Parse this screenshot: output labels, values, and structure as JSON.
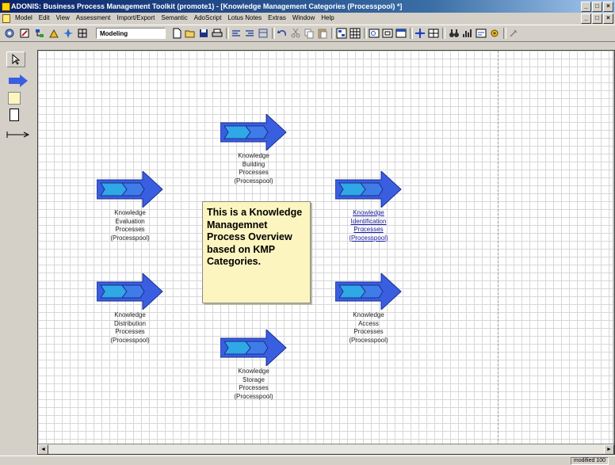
{
  "window": {
    "title": "ADONIS: Business Process Management Toolkit (promote1) - [Knowledge Management Categories (Processpool) *]",
    "min_glyph": "_",
    "max_glyph": "□",
    "close_glyph": "×"
  },
  "menubar": {
    "items": [
      "Model",
      "Edit",
      "View",
      "Assessment",
      "Import/Export",
      "Semantic",
      "AdoScript",
      "Lotus Notes",
      "Extras",
      "Window",
      "Help"
    ]
  },
  "toolbar": {
    "mode": "Modeling"
  },
  "canvas": {
    "processes": [
      {
        "label": "Knowledge\nBuilding\nProcesses\n(Processpool)",
        "link": false
      },
      {
        "label": "Knowledge\nEvaluation\nProcesses\n(Processpool)",
        "link": false
      },
      {
        "label": "Knowledge\nIdentification\nProcesses\n(Processpool)",
        "link": true
      },
      {
        "label": "Knowledge\nDistribution\nProcesses\n(Processpool)",
        "link": false
      },
      {
        "label": "Knowledge\nAccess\nProcesses\n(Processpool)",
        "link": false
      },
      {
        "label": "Knowledge\nStorage\nProcesses\n(Processpool)",
        "link": false
      }
    ],
    "note": "This is a Knowledge Managemnet Process Overview based on KMP Categories."
  },
  "statusbar": {
    "text": "modified  100"
  },
  "colors": {
    "arrow_fill": "#3a5ee0",
    "arrow_inner": "#2fa8e6",
    "note_bg": "#fdf5c0",
    "titlebar": "#0a246a"
  }
}
